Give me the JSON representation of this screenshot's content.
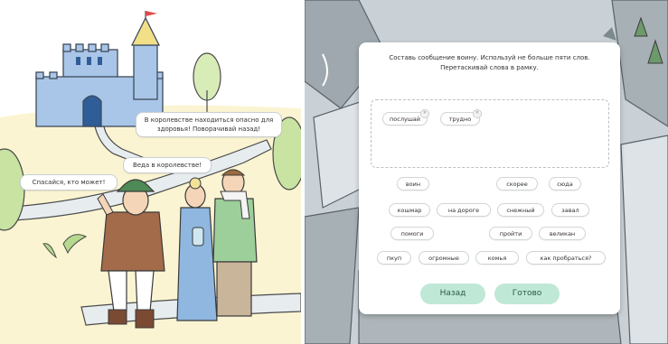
{
  "scene": {
    "bubbles": {
      "castle_warning": "В королевстве находиться опасно для здоровья! Поворачивай назад!",
      "road_question": "Веда в королевстве!",
      "farewell": "Спасайся, кто может!"
    }
  },
  "dialog": {
    "instruction": "Составь сообщение воину. Используй не больше пяти слов. Перетаскивай слова в рамку.",
    "selected_words": [
      "послушай",
      "трудно"
    ],
    "word_bank": [
      [
        "воин",
        "скорее",
        "сюда"
      ],
      [
        "кошмар",
        "на дороге",
        "снежный",
        "завал"
      ],
      [
        "помоги",
        "пройти",
        "великан"
      ],
      [
        "пкуп",
        "огромные",
        "комья",
        "как пробраться?"
      ]
    ],
    "back_button": "Назад",
    "done_button": "Готово"
  },
  "colors": {
    "button_bg": "#bfe8d6",
    "button_text": "#2d5a48",
    "castle": "#a9c6e8",
    "flag": "#e04a4a"
  }
}
